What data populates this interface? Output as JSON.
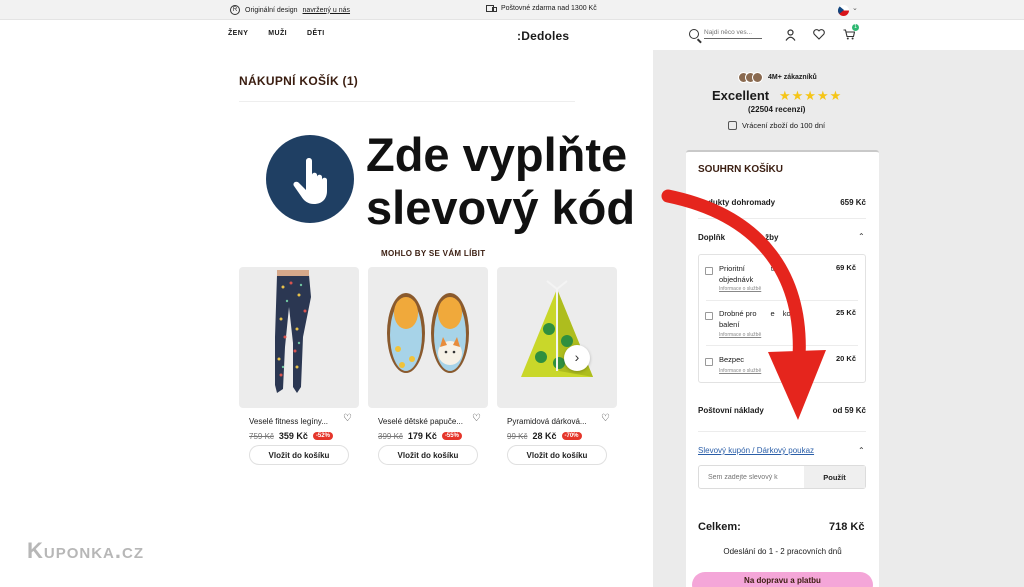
{
  "topbar": {
    "original_text": "Originální design",
    "original_link": "navržený u nás",
    "shipping_text": "Poštovné zdarma nad 1300 Kč"
  },
  "header": {
    "nav": [
      "ŽENY",
      "MUŽI",
      "DĚTI"
    ],
    "logo": "Dedoles",
    "search_placeholder": "Najdi něco ves...",
    "cart_count": "1"
  },
  "cart": {
    "title": "NÁKUPNÍ KOŠÍK (1)"
  },
  "overlay": {
    "text": "Zde vyplňte\nslevový kód",
    "arrow_color": "#e5251d"
  },
  "recommendations": {
    "title": "MOHLO BY SE VÁM LÍBIT",
    "products": [
      {
        "name": "Veselé fitness legíny...",
        "old_price": "759 Kč",
        "price": "359 Kč",
        "discount": "-52%",
        "button": "Vložit do košíku"
      },
      {
        "name": "Veselé dětské papuče...",
        "old_price": "399 Kč",
        "price": "179 Kč",
        "discount": "-55%",
        "button": "Vložit do košíku"
      },
      {
        "name": "Pyramidová dárková...",
        "old_price": "99 Kč",
        "price": "28 Kč",
        "discount": "-70%",
        "button": "Vložit do košíku"
      }
    ]
  },
  "reviews": {
    "customers": "4M+ zákazníků",
    "rating_word": "Excellent",
    "stars": "★★★★★",
    "count": "(22504 recenzí)",
    "returns": "Vrácení zboží do 100 dní"
  },
  "summary": {
    "title": "SOUHRN KOŠÍKU",
    "products_label": "dukty dohromady",
    "products_value": "659 Kč",
    "addons_label": "Doplňk",
    "addons_label_tail": "žby",
    "addons": [
      {
        "name_a": "Prioritní",
        "name_b": "tání",
        "name_c": "objednávk",
        "price": "69 Kč",
        "info": "Informace o službě"
      },
      {
        "name_a": "Drobné pro",
        "name_b": "e",
        "name_c": "kové",
        "name_d": "balení",
        "price": "25 Kč",
        "info": "Informace o službě"
      },
      {
        "name_a": "Bezpec",
        "price": "20 Kč",
        "info": "Informace o službě"
      }
    ],
    "shipping_label": "Poštovní náklady",
    "shipping_value": "od 59 Kč",
    "coupon_label": "Slevový kupón / Dárkový poukaz",
    "coupon_placeholder": "Sem zadejte slevový k",
    "coupon_button": "Použít",
    "total_label": "Celkem:",
    "total_value": "718 Kč",
    "shipping_time": "Odeslání do 1 - 2 pracovních dnů",
    "checkout_button": "Na dopravu a platbu"
  },
  "watermark": "Kuponka.cz"
}
